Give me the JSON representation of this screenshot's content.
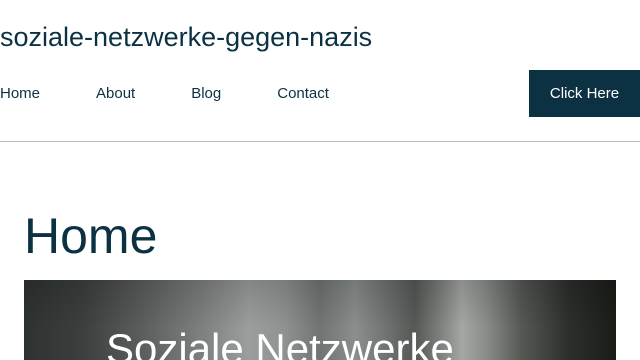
{
  "header": {
    "site_title": "soziale-netzwerke-gegen-nazis",
    "nav": [
      {
        "label": "Home"
      },
      {
        "label": "About"
      },
      {
        "label": "Blog"
      },
      {
        "label": "Contact"
      }
    ],
    "cta_label": "Click Here"
  },
  "main": {
    "heading": "Home",
    "hero_title": "Soziale Netzwerke"
  },
  "colors": {
    "brand": "#0b3142",
    "divider": "#b9bcc6",
    "background": "#ffffff"
  }
}
